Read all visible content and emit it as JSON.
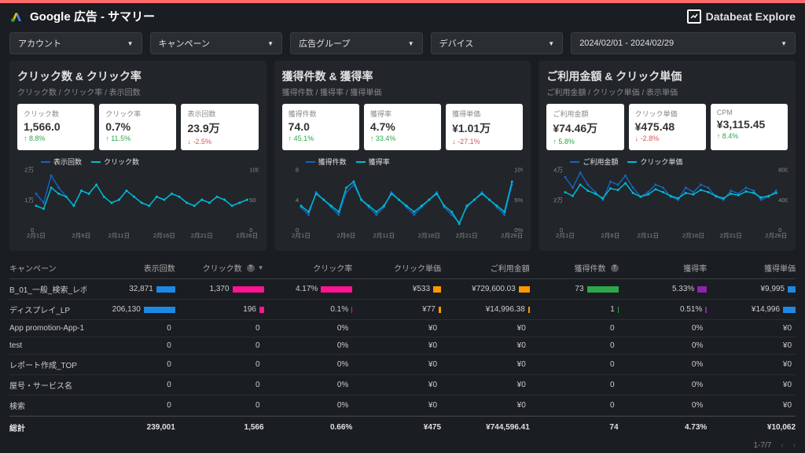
{
  "header": {
    "title": "Google 広告 - サマリー",
    "brand": "Databeat Explore"
  },
  "filters": {
    "account": "アカウント",
    "campaign": "キャンペーン",
    "adgroup": "広告グループ",
    "device": "デバイス",
    "daterange": "2024/02/01 - 2024/02/29"
  },
  "panels": [
    {
      "title": "クリック数 & クリック率",
      "sub": "クリック数 / クリック率 / 表示回数",
      "cards": [
        {
          "label": "クリック数",
          "value": "1,566.0",
          "change": "8.8%",
          "dir": "up"
        },
        {
          "label": "クリック率",
          "value": "0.7%",
          "change": "11.5%",
          "dir": "up"
        },
        {
          "label": "表示回数",
          "value": "23.9万",
          "change": "-2.5%",
          "dir": "down"
        }
      ],
      "legend": [
        "表示回数",
        "クリック数"
      ]
    },
    {
      "title": "獲得件数 & 獲得率",
      "sub": "獲得件数 / 獲得率 / 獲得単価",
      "cards": [
        {
          "label": "獲得件数",
          "value": "74.0",
          "change": "45.1%",
          "dir": "up"
        },
        {
          "label": "獲得率",
          "value": "4.7%",
          "change": "33.4%",
          "dir": "up"
        },
        {
          "label": "獲得単価",
          "value": "¥1.01万",
          "change": "-27.1%",
          "dir": "down"
        }
      ],
      "legend": [
        "獲得件数",
        "獲得率"
      ]
    },
    {
      "title": "ご利用金額 & クリック単価",
      "sub": "ご利用金額 / クリック単価 / 表示単価",
      "cards": [
        {
          "label": "ご利用金額",
          "value": "¥74.46万",
          "change": "5.8%",
          "dir": "up"
        },
        {
          "label": "クリック単価",
          "value": "¥475.48",
          "change": "-2.8%",
          "dir": "down"
        },
        {
          "label": "CPM",
          "value": "¥3,115.45",
          "change": "8.4%",
          "dir": "up"
        }
      ],
      "legend": [
        "ご利用金額",
        "クリック単価"
      ]
    }
  ],
  "chart_data": [
    {
      "type": "line",
      "categories": [
        "2月1日",
        "2月6日",
        "2月11日",
        "2月16日",
        "2月21日",
        "2月26日"
      ],
      "series": [
        {
          "name": "表示回数",
          "values": [
            12000,
            9000,
            18000,
            14000,
            11000,
            8000,
            13000,
            12000,
            15000,
            11000,
            9000,
            10000,
            13000,
            11000,
            9000,
            8000,
            11000,
            10000,
            12000,
            11000,
            9000,
            8000,
            10000,
            9000,
            11000,
            10000,
            8000,
            9000,
            10000
          ]
        },
        {
          "name": "クリック数",
          "values": [
            40,
            35,
            70,
            60,
            55,
            40,
            65,
            60,
            75,
            55,
            45,
            50,
            65,
            55,
            45,
            40,
            55,
            50,
            60,
            55,
            45,
            40,
            50,
            45,
            55,
            50,
            40,
            45,
            50
          ]
        }
      ],
      "ylabel_left": "",
      "ylim_left": [
        0,
        20000
      ],
      "ylabel_right": "",
      "ylim_right": [
        0,
        100
      ]
    },
    {
      "type": "line",
      "categories": [
        "2月1日",
        "2月6日",
        "2月11日",
        "2月16日",
        "2月21日",
        "2月26日"
      ],
      "series": [
        {
          "name": "獲得件数",
          "values": [
            3,
            2,
            5,
            4,
            3,
            2,
            5,
            6,
            4,
            3,
            2,
            3,
            5,
            4,
            3,
            2,
            3,
            4,
            5,
            3,
            2,
            1,
            3,
            4,
            5,
            4,
            3,
            2,
            6
          ]
        },
        {
          "name": "獲得率",
          "values": [
            4,
            3,
            6,
            5,
            4,
            3,
            7,
            8,
            5,
            4,
            3,
            4,
            6,
            5,
            4,
            3,
            4,
            5,
            6,
            4,
            3,
            1,
            4,
            5,
            6,
            5,
            4,
            3,
            8
          ]
        }
      ],
      "ylim_left": [
        0,
        8
      ],
      "ylim_right": [
        0,
        10
      ]
    },
    {
      "type": "line",
      "categories": [
        "2月1日",
        "2月6日",
        "2月11日",
        "2月16日",
        "2月21日",
        "2月26日"
      ],
      "series": [
        {
          "name": "ご利用金額",
          "values": [
            35000,
            28000,
            38000,
            30000,
            25000,
            20000,
            32000,
            30000,
            36000,
            28000,
            22000,
            25000,
            30000,
            28000,
            22000,
            20000,
            28000,
            25000,
            30000,
            28000,
            22000,
            20000,
            26000,
            24000,
            28000,
            26000,
            20000,
            22000,
            26000
          ]
        },
        {
          "name": "クリック単価",
          "values": [
            500,
            450,
            600,
            520,
            480,
            420,
            550,
            530,
            620,
            490,
            440,
            470,
            540,
            500,
            450,
            420,
            490,
            470,
            530,
            500,
            450,
            420,
            480,
            460,
            510,
            490,
            430,
            450,
            490
          ]
        }
      ],
      "ylim_left": [
        0,
        40000
      ],
      "ylim_right": [
        0,
        800
      ]
    }
  ],
  "table": {
    "headers": [
      "キャンペーン",
      "表示回数",
      "クリック数",
      "クリック率",
      "クリック単価",
      "ご利用金額",
      "獲得件数",
      "獲得率",
      "獲得単価"
    ],
    "rows": [
      {
        "c": [
          "B_01_一般_検索_レポ...",
          "32,871",
          "1,370",
          "4.17%",
          "¥533",
          "¥729,600.03",
          "73",
          "5.33%",
          "¥9,995"
        ],
        "bars": [
          60,
          100,
          100,
          25,
          35,
          100,
          30,
          25
        ],
        "colors": [
          "#1e88e5",
          "#ff1493",
          "#ff1493",
          "#ff9800",
          "#ff9800",
          "#2ba84a",
          "#8e24aa",
          "#1e88e5"
        ]
      },
      {
        "c": [
          "ディスプレイ_LP",
          "206,130",
          "196",
          "0.1%",
          "¥77",
          "¥14,996.38",
          "1",
          "0.51%",
          "¥14,996"
        ],
        "bars": [
          100,
          14,
          3,
          8,
          5,
          2,
          5,
          40
        ],
        "colors": [
          "#1e88e5",
          "#ff1493",
          "#ff1493",
          "#ff9800",
          "#ff9800",
          "#2ba84a",
          "#8e24aa",
          "#1e88e5"
        ]
      },
      {
        "c": [
          "App promotion-App-1",
          "0",
          "0",
          "0%",
          "¥0",
          "¥0",
          "0",
          "0%",
          "¥0"
        ],
        "bars": [
          0,
          0,
          0,
          0,
          0,
          0,
          0,
          0
        ],
        "colors": [
          "",
          "",
          "",
          "",
          "",
          "",
          "",
          ""
        ]
      },
      {
        "c": [
          "test",
          "0",
          "0",
          "0%",
          "¥0",
          "¥0",
          "0",
          "0%",
          "¥0"
        ],
        "bars": [
          0,
          0,
          0,
          0,
          0,
          0,
          0,
          0
        ],
        "colors": [
          "",
          "",
          "",
          "",
          "",
          "",
          "",
          ""
        ]
      },
      {
        "c": [
          "レポート作成_TOP",
          "0",
          "0",
          "0%",
          "¥0",
          "¥0",
          "0",
          "0%",
          "¥0"
        ],
        "bars": [
          0,
          0,
          0,
          0,
          0,
          0,
          0,
          0
        ],
        "colors": [
          "",
          "",
          "",
          "",
          "",
          "",
          "",
          ""
        ]
      },
      {
        "c": [
          "屋号・サービス名",
          "0",
          "0",
          "0%",
          "¥0",
          "¥0",
          "0",
          "0%",
          "¥0"
        ],
        "bars": [
          0,
          0,
          0,
          0,
          0,
          0,
          0,
          0
        ],
        "colors": [
          "",
          "",
          "",
          "",
          "",
          "",
          "",
          ""
        ]
      },
      {
        "c": [
          "検索",
          "0",
          "0",
          "0%",
          "¥0",
          "¥0",
          "0",
          "0%",
          "¥0"
        ],
        "bars": [
          0,
          0,
          0,
          0,
          0,
          0,
          0,
          0
        ],
        "colors": [
          "",
          "",
          "",
          "",
          "",
          "",
          "",
          ""
        ]
      }
    ],
    "footer": [
      "総計",
      "239,001",
      "1,566",
      "0.66%",
      "¥475",
      "¥744,596.41",
      "74",
      "4.73%",
      "¥10,062"
    ],
    "pager": "1-7/7"
  }
}
